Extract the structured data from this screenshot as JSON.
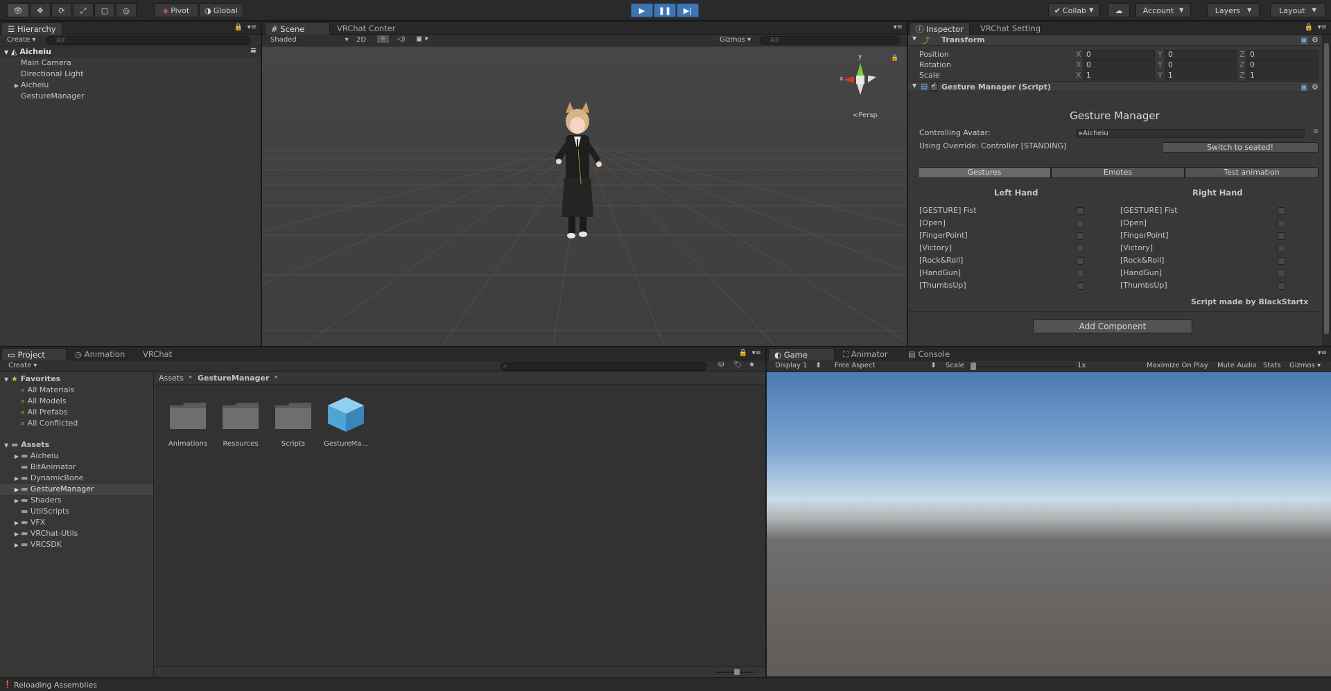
{
  "toolbar": {
    "pivot": "Pivot",
    "global": "Global",
    "collab": "Collab",
    "account": "Account",
    "layers": "Layers",
    "layout": "Layout"
  },
  "hierarchy": {
    "tab": "Hierarchy",
    "create": "Create",
    "search_placeholder": "All",
    "scene": "Aicheiu",
    "items": [
      "Main Camera",
      "Directional Light",
      "Aicheiu",
      "GestureManager"
    ]
  },
  "scene": {
    "tabs": [
      "Scene",
      "VRChat Conter"
    ],
    "shading": "Shaded",
    "mode_2d": "2D",
    "gizmos": "Gizmos",
    "search_placeholder": "All",
    "persp": "Persp",
    "axis_y": "y",
    "axis_x": "x"
  },
  "inspector": {
    "tabs": [
      "Inspector",
      "VRChat Setting"
    ],
    "transform": {
      "title": "Transform",
      "position_label": "Position",
      "rotation_label": "Rotation",
      "scale_label": "Scale",
      "axis_x": "X",
      "axis_y": "Y",
      "axis_z": "Z",
      "position": [
        "0",
        "0",
        "0"
      ],
      "rotation": [
        "0",
        "0",
        "0"
      ],
      "scale": [
        "1",
        "1",
        "1"
      ]
    },
    "gesture": {
      "component": "Gesture Manager (Script)",
      "title": "Gesture Manager",
      "controlling_label": "Controlling Avatar:",
      "controlling_value": "Aicheiu",
      "override_text": "Using Override: Controller [STANDING]",
      "switch_button": "Switch to seated!",
      "tabs": [
        "Gestures",
        "Emotes",
        "Test animation"
      ],
      "left_hand": "Left Hand",
      "right_hand": "Right Hand",
      "gestures": [
        "[GESTURE] Fist",
        "[Open]",
        "[FingerPoint]",
        "[Victory]",
        "[Rock&Roll]",
        "[HandGun]",
        "[ThumbsUp]"
      ],
      "credit": "Script made by BlackStartx"
    },
    "add_component": "Add Component"
  },
  "project": {
    "tabs": [
      "Project",
      "Animation",
      "VRChat"
    ],
    "create": "Create",
    "favorites_label": "Favorites",
    "favorites": [
      "All Materials",
      "All Models",
      "All Prefabs",
      "All Conflicted"
    ],
    "assets_label": "Assets",
    "assets": [
      "Aicheiu",
      "BitAnimator",
      "DynamicBone",
      "GestureManager",
      "Shaders",
      "UtilScripts",
      "VFX",
      "VRChat-Utils",
      "VRCSDK"
    ],
    "breadcrumb_root": "Assets",
    "breadcrumb_current": "GestureManager",
    "grid_items": [
      "Animations",
      "Resources",
      "Scripts",
      "GestureMa..."
    ]
  },
  "game": {
    "tabs": [
      "Game",
      "Animator",
      "Console"
    ],
    "display": "Display 1",
    "aspect": "Free Aspect",
    "scale_label": "Scale",
    "scale_value": "1x",
    "maximize": "Maximize On Play",
    "mute": "Mute Audio",
    "stats": "Stats",
    "gizmos": "Gizmos"
  },
  "status": {
    "text": "Reloading Assemblies"
  },
  "colors": {
    "accent": "#3f74b3",
    "selection": "#3e4a5c"
  }
}
